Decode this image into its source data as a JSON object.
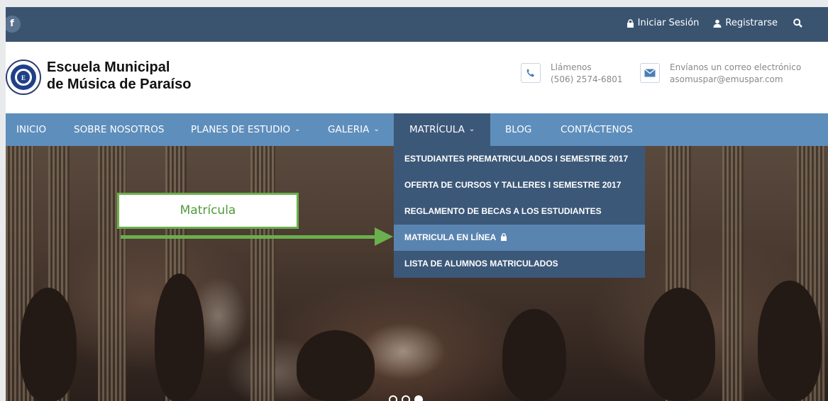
{
  "topbar": {
    "facebook_icon": "facebook-icon",
    "login_label": "Iniciar Sesión",
    "register_label": "Registrarse",
    "search_icon": "search-icon"
  },
  "header": {
    "school_name_line1": "Escuela Municipal",
    "school_name_line2": "de Música de Paraíso",
    "phone": {
      "label": "Llámenos",
      "value": "(506) 2574-6801",
      "icon": "phone-icon"
    },
    "email": {
      "label": "Envíanos un correo electrónico",
      "value": "asomuspar@emuspar.com",
      "icon": "envelope-icon"
    }
  },
  "nav": {
    "items": [
      {
        "label": "INICIO"
      },
      {
        "label": "SOBRE NOSOTROS"
      },
      {
        "label": "PLANES DE ESTUDIO"
      },
      {
        "label": "GALERIA"
      },
      {
        "label": "MATRÍCULA"
      },
      {
        "label": "BLOG"
      },
      {
        "label": "CONTÁCTENOS"
      }
    ]
  },
  "dropdown": {
    "items": [
      {
        "label": "ESTUDIANTES PREMATRICULADOS I SEMESTRE 2017"
      },
      {
        "label": "OFERTA DE CURSOS Y TALLERES I SEMESTRE 2017"
      },
      {
        "label": "REGLAMENTO DE BECAS A LOS ESTUDIANTES"
      },
      {
        "label": "MATRICULA EN LÍNEA"
      },
      {
        "label": "LISTA DE ALUMNOS MATRICULADOS"
      }
    ]
  },
  "annotation": {
    "callout_text": "Matrícula",
    "color": "#6ab04c"
  },
  "colors": {
    "topbar": "#3a5470",
    "nav": "#5e8ebc",
    "nav_active": "#3c5878",
    "dropdown_highlight": "#5a84b0"
  }
}
